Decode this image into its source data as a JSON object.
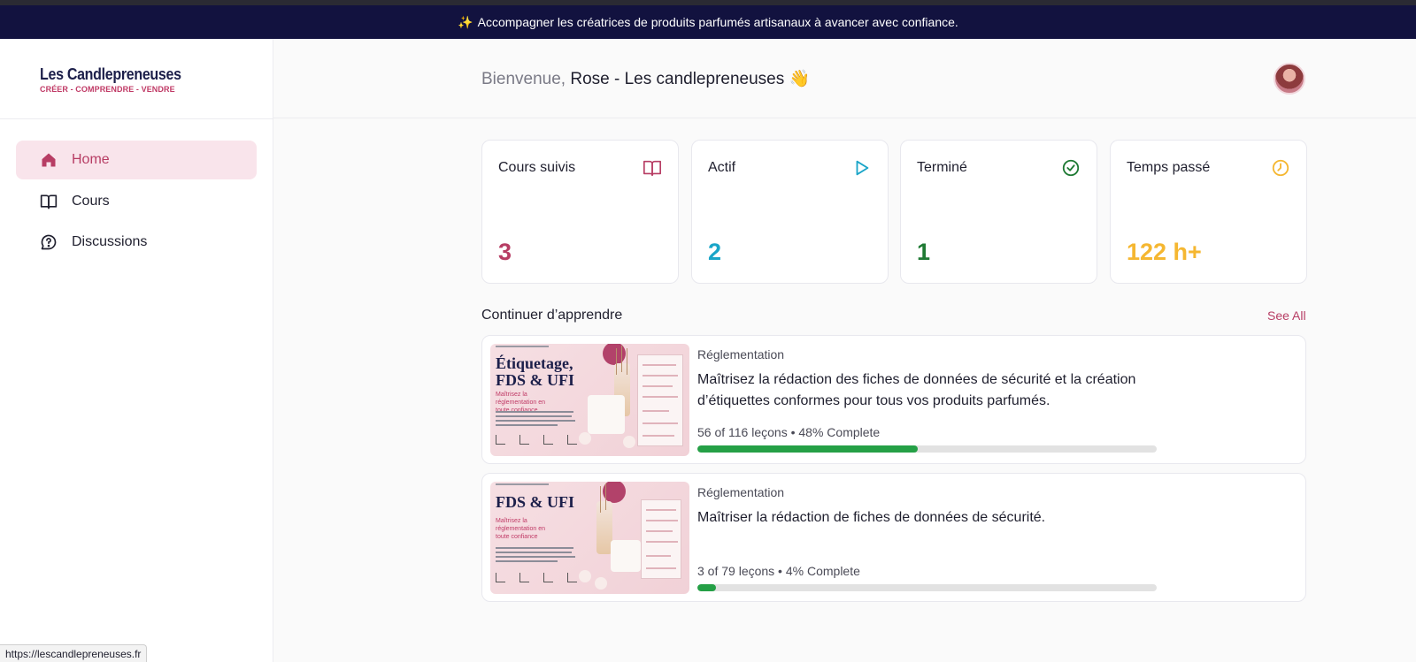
{
  "banner": {
    "icon": "sparkles-icon",
    "text": "Accompagner les créatrices de produits parfumés artisanaux à avancer avec confiance."
  },
  "logo": {
    "title": "Les Candlepreneuses",
    "tagline": "CRÉER - COMPRENDRE - VENDRE"
  },
  "sidebar": {
    "items": [
      {
        "label": "Home",
        "icon": "home-icon",
        "active": true
      },
      {
        "label": "Cours",
        "icon": "book-icon",
        "active": false
      },
      {
        "label": "Discussions",
        "icon": "help-circle-icon",
        "active": false
      }
    ]
  },
  "header": {
    "greeting_prefix": "Bienvenue,",
    "user_name": "Rose - Les candlepreneuses",
    "emoji": "👋"
  },
  "stats": [
    {
      "label": "Cours suivis",
      "value": "3",
      "icon": "book-open-icon",
      "color": "#b73d64"
    },
    {
      "label": "Actif",
      "value": "2",
      "icon": "play-icon",
      "color": "#1aa5c8"
    },
    {
      "label": "Terminé",
      "value": "1",
      "icon": "check-circle-icon",
      "color": "#1f7a34"
    },
    {
      "label": "Temps passé",
      "value": "122 h+",
      "icon": "clock-icon",
      "color": "#f5b731"
    }
  ],
  "continue": {
    "title": "Continuer d’apprendre",
    "see_all": "See All"
  },
  "courses": [
    {
      "category": "Réglementation",
      "title": "Maîtrisez la rédaction des fiches de données de sécurité et la création d’étiquettes conformes pour tous vos produits parfumés.",
      "progress_text": "56 of 116 leçons • 48% Complete",
      "progress": 0.48,
      "thumb_title": "Étiquetage, FDS & UFI",
      "thumb_subtitle": "Maîtrisez la réglementation en toute confiance"
    },
    {
      "category": "Réglementation",
      "title": "Maîtriser la rédaction de fiches de données de sécurité.",
      "progress_text": "3 of 79 leçons • 4% Complete",
      "progress": 0.04,
      "thumb_title": "FDS & UFI",
      "thumb_subtitle": "Maîtrisez la réglementation en toute confiance"
    }
  ],
  "status_url": "https://lescandlepreneuses.fr",
  "colors": {
    "brand": "#b73d64",
    "banner_bg": "#12123f",
    "progress": "#25a046"
  }
}
